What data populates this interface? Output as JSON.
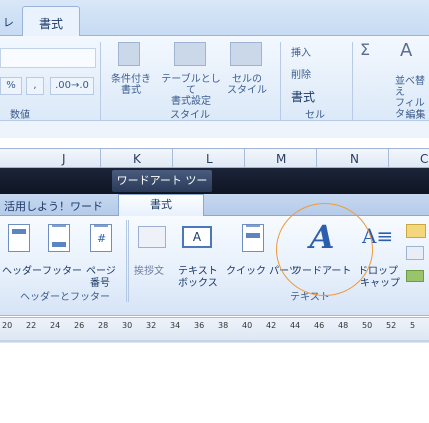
{
  "excel": {
    "tab_prev": "レ",
    "tab_active": "書式",
    "groups": [
      "数値",
      "スタイル",
      "セル",
      "編集"
    ],
    "number_format": {
      "percent": "%",
      "comma": ",",
      "inc_dec": ".00→.0"
    },
    "styles": {
      "conditional": "条件付き\n書式",
      "table": "テーブルとして\n書式設定",
      "cell": "セルの\nスタイル"
    },
    "cells": {
      "insert": "挿入",
      "delete": "削除",
      "format": "書式"
    },
    "editing": {
      "sort": "並べ替え\nフィルタ"
    }
  },
  "columns": [
    "J",
    "K",
    "L",
    "M",
    "N",
    "C"
  ],
  "word": {
    "contextual_tab": "ワードアート ツール",
    "tabs": {
      "left": "活用しよう！ワード",
      "active": "書式"
    },
    "buttons": [
      {
        "label": "ヘッダー",
        "sub": ""
      },
      {
        "label": "フッター",
        "sub": ""
      },
      {
        "label": "ページ",
        "sub": "番号"
      },
      {
        "label": "挨拶文",
        "sub": ""
      },
      {
        "label": "テキスト",
        "sub": "ボックス"
      },
      {
        "label": "クイック パーツ",
        "sub": ""
      },
      {
        "label": "ワードアート",
        "sub": ""
      },
      {
        "label": "ドロップ",
        "sub": "キャップ"
      }
    ],
    "groups": {
      "header_footer": "ヘッダーとフッター",
      "text": "テキスト"
    },
    "ruler_ticks": [
      "20",
      "22",
      "24",
      "26",
      "28",
      "30",
      "32",
      "34",
      "36",
      "38",
      "40",
      "42",
      "44",
      "46",
      "48",
      "50",
      "52",
      "5"
    ]
  },
  "colors": {
    "highlight": "#f09a3a",
    "title_bar": "#141c2e",
    "accent_blue": "#2b5fae"
  }
}
